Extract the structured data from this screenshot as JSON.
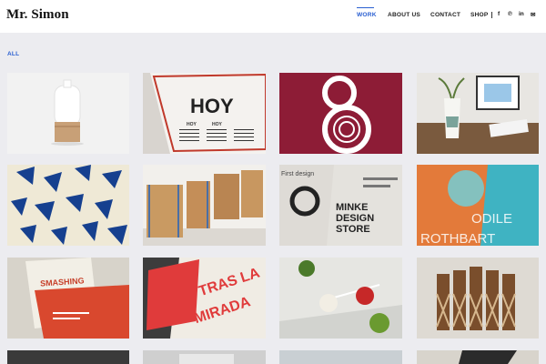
{
  "site": {
    "logo": "Mr. Simon"
  },
  "nav": {
    "items": [
      {
        "label": "WORK",
        "active": true
      },
      {
        "label": "ABOUT US",
        "active": false
      },
      {
        "label": "CONTACT",
        "active": false
      },
      {
        "label": "SHOP",
        "active": false
      }
    ],
    "social": [
      {
        "name": "facebook-icon",
        "glyph": "f"
      },
      {
        "name": "pinterest-icon",
        "glyph": "℗"
      },
      {
        "name": "linkedin-icon",
        "glyph": "in"
      },
      {
        "name": "mail-icon",
        "glyph": "✉"
      }
    ],
    "accent": "#2a5fd1"
  },
  "filter": {
    "label": "ALL"
  },
  "portfolio": {
    "tiles": [
      {
        "name": "tile-ceramic-bottle",
        "alt": "ceramic bottle"
      },
      {
        "name": "tile-hoy-calendar",
        "text": "HOY",
        "sub": "HOY"
      },
      {
        "name": "tile-ampersand-logo"
      },
      {
        "name": "tile-vase-desk"
      },
      {
        "name": "tile-blue-cards"
      },
      {
        "name": "tile-wood-blocks"
      },
      {
        "name": "tile-minke-design",
        "text1": "MINKE",
        "text2": "DESIGN",
        "text3": "STORE",
        "text4": "First design"
      },
      {
        "name": "tile-odile-rothbart",
        "text1": "ODILE",
        "text2": "ROTHBART"
      },
      {
        "name": "tile-smashing-book",
        "text": "SMASHING"
      },
      {
        "name": "tile-tras-la-mirada",
        "text1": "TRAS LA",
        "text2": "MIRADA"
      },
      {
        "name": "tile-lollipops"
      },
      {
        "name": "tile-wood-chairs"
      },
      {
        "name": "tile-partial-1"
      },
      {
        "name": "tile-partial-2"
      },
      {
        "name": "tile-partial-3"
      },
      {
        "name": "tile-partial-4"
      }
    ]
  }
}
